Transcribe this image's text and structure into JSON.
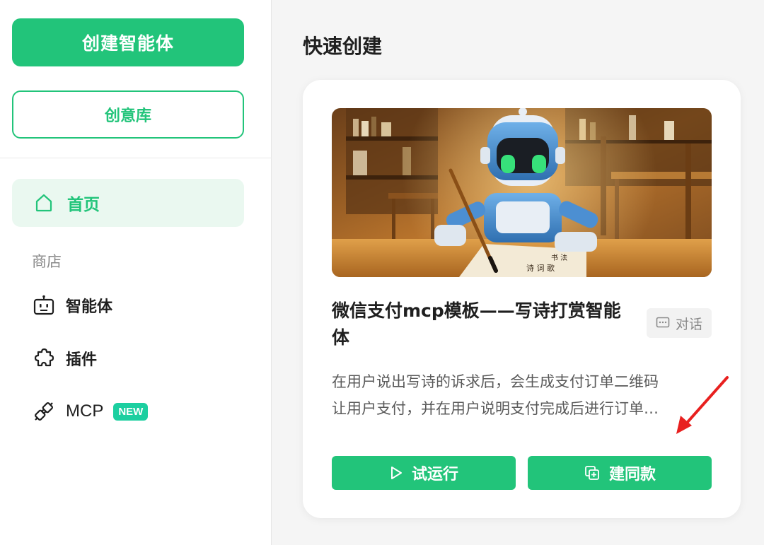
{
  "sidebar": {
    "create_agent_label": "创建智能体",
    "library_label": "创意库",
    "home_label": "首页",
    "store_section_label": "商店",
    "items": [
      {
        "label": "智能体",
        "icon": "robot-icon"
      },
      {
        "label": "插件",
        "icon": "puzzle-icon"
      },
      {
        "label": "MCP",
        "icon": "plug-icon",
        "badge": "NEW"
      }
    ]
  },
  "main": {
    "title": "快速创建",
    "card": {
      "title": "微信支付mcp模板——写诗打赏智能体",
      "tag": "对话",
      "description_line1": "在用户说出写诗的诉求后，会生成支付订单二维码",
      "description_line2": "让用户支付，并在用户说明支付完成后进行订单…",
      "run_label": "试运行",
      "clone_label": "建同款"
    }
  },
  "colors": {
    "accent": "#22c47a",
    "badge": "#1ccfa0",
    "annotation_arrow": "#e8201f"
  }
}
